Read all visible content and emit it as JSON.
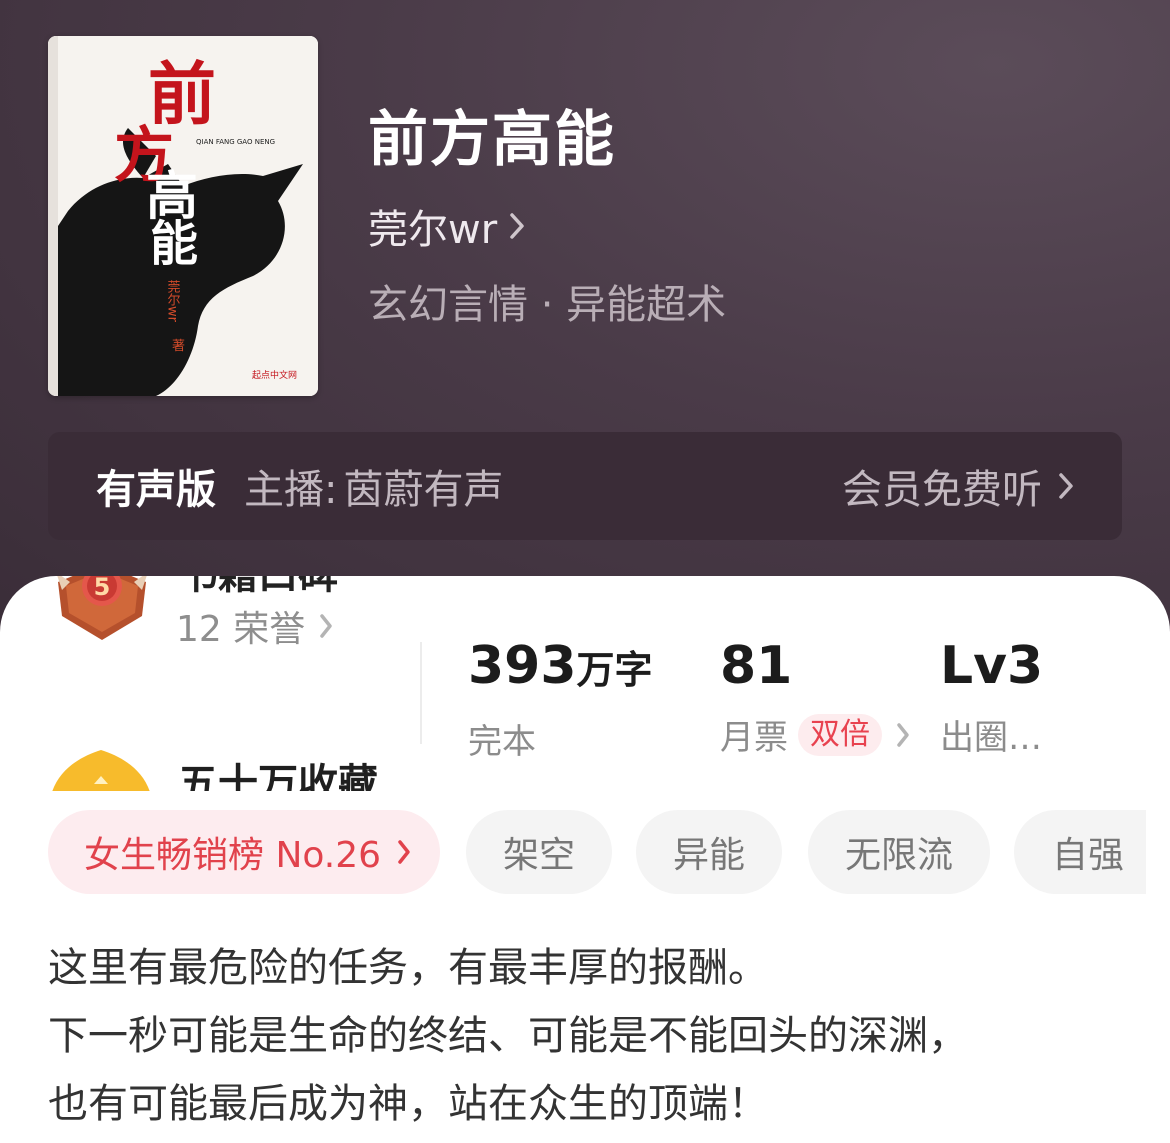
{
  "book": {
    "title": "前方高能",
    "author": "莞尔wr",
    "genre": "玄幻言情 · 异能超术"
  },
  "cover": {
    "title_chars": [
      "前",
      "方",
      "高",
      "能"
    ],
    "author_vertical": "莞尔wr",
    "author_suffix": "著",
    "pinyin": "QIAN FANG GAO NENG",
    "publisher": "起点中文网"
  },
  "audio": {
    "label": "有声版",
    "host_prefix": "主播:",
    "host": "茵蔚有声",
    "action": "会员免费听"
  },
  "honor": {
    "medal_level": "5",
    "cut_text": "书籍口碑",
    "honor_count": "12 荣誉",
    "collect_label": "五十万收藏"
  },
  "stats": {
    "words_value": "393",
    "words_unit": "万字",
    "words_label": "完本",
    "tickets_value": "81",
    "tickets_label": "月票",
    "tickets_tag": "双倍",
    "level_value": "Lv3",
    "level_label": "出圈…"
  },
  "tags": {
    "rank": "女生畅销榜 No.26",
    "items": [
      "架空",
      "异能",
      "无限流",
      "自强"
    ]
  },
  "description": [
    "这里有最危险的任务，有最丰厚的报酬。",
    "下一秒可能是生命的终结、可能是不能回头的深渊，",
    "也有可能最后成为神，站在众生的顶端！"
  ],
  "colors": {
    "header_bg": "#4a3b48",
    "audio_bar_bg": "#3a2c37",
    "accent_red": "#e1424c",
    "rank_chip_bg": "#fdecef",
    "chip_bg": "#f4f4f4",
    "medal": "#c8542b",
    "crown": "#f7bb2c"
  },
  "icons": [
    "chevron-right-icon",
    "medal-icon",
    "crown-icon"
  ]
}
